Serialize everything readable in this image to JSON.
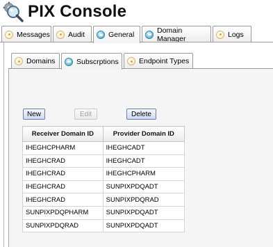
{
  "app": {
    "title": "PIX Console"
  },
  "main_tabs": [
    {
      "label": "Messages",
      "active": false
    },
    {
      "label": "Audit",
      "active": false
    },
    {
      "label": "General",
      "active": true
    },
    {
      "label": "Domain Manager",
      "active": false
    },
    {
      "label": "Logs",
      "active": false
    }
  ],
  "sub_tabs": [
    {
      "label": "Domains",
      "active": false
    },
    {
      "label": "Subscrptions",
      "active": true
    },
    {
      "label": "Endpoint Types",
      "active": false
    }
  ],
  "toolbar": {
    "new_label": "New",
    "edit_label": "Edit",
    "edit_enabled": false,
    "delete_label": "Delete"
  },
  "table": {
    "headers": [
      "Receiver Domain ID",
      "Provider Domain ID"
    ],
    "rows": [
      [
        "IHEGHCPHARM",
        "IHEGHCADT"
      ],
      [
        "IHEGHCRAD",
        "IHEGHCADT"
      ],
      [
        "IHEGHCRAD",
        "IHEGHCPHARM"
      ],
      [
        "IHEGHCRAD",
        "SUNPIXPDQADT"
      ],
      [
        "IHEGHCRAD",
        "SUNPIXPDQRAD"
      ],
      [
        "SUNPIXPDQPHARM",
        "SUNPIXPDQADT"
      ],
      [
        "SUNPIXPDQRAD",
        "SUNPIXPDQADT"
      ]
    ]
  },
  "icons": {
    "logo": "magnifier-gear-icon",
    "tab_inactive": "orange-dot-icon",
    "tab_active": "blue-dot-icon"
  },
  "colors": {
    "active_tab_icon": "#5fb4d2",
    "inactive_tab_icon": "#e3a52a",
    "button_border": "#6d7fa6"
  }
}
